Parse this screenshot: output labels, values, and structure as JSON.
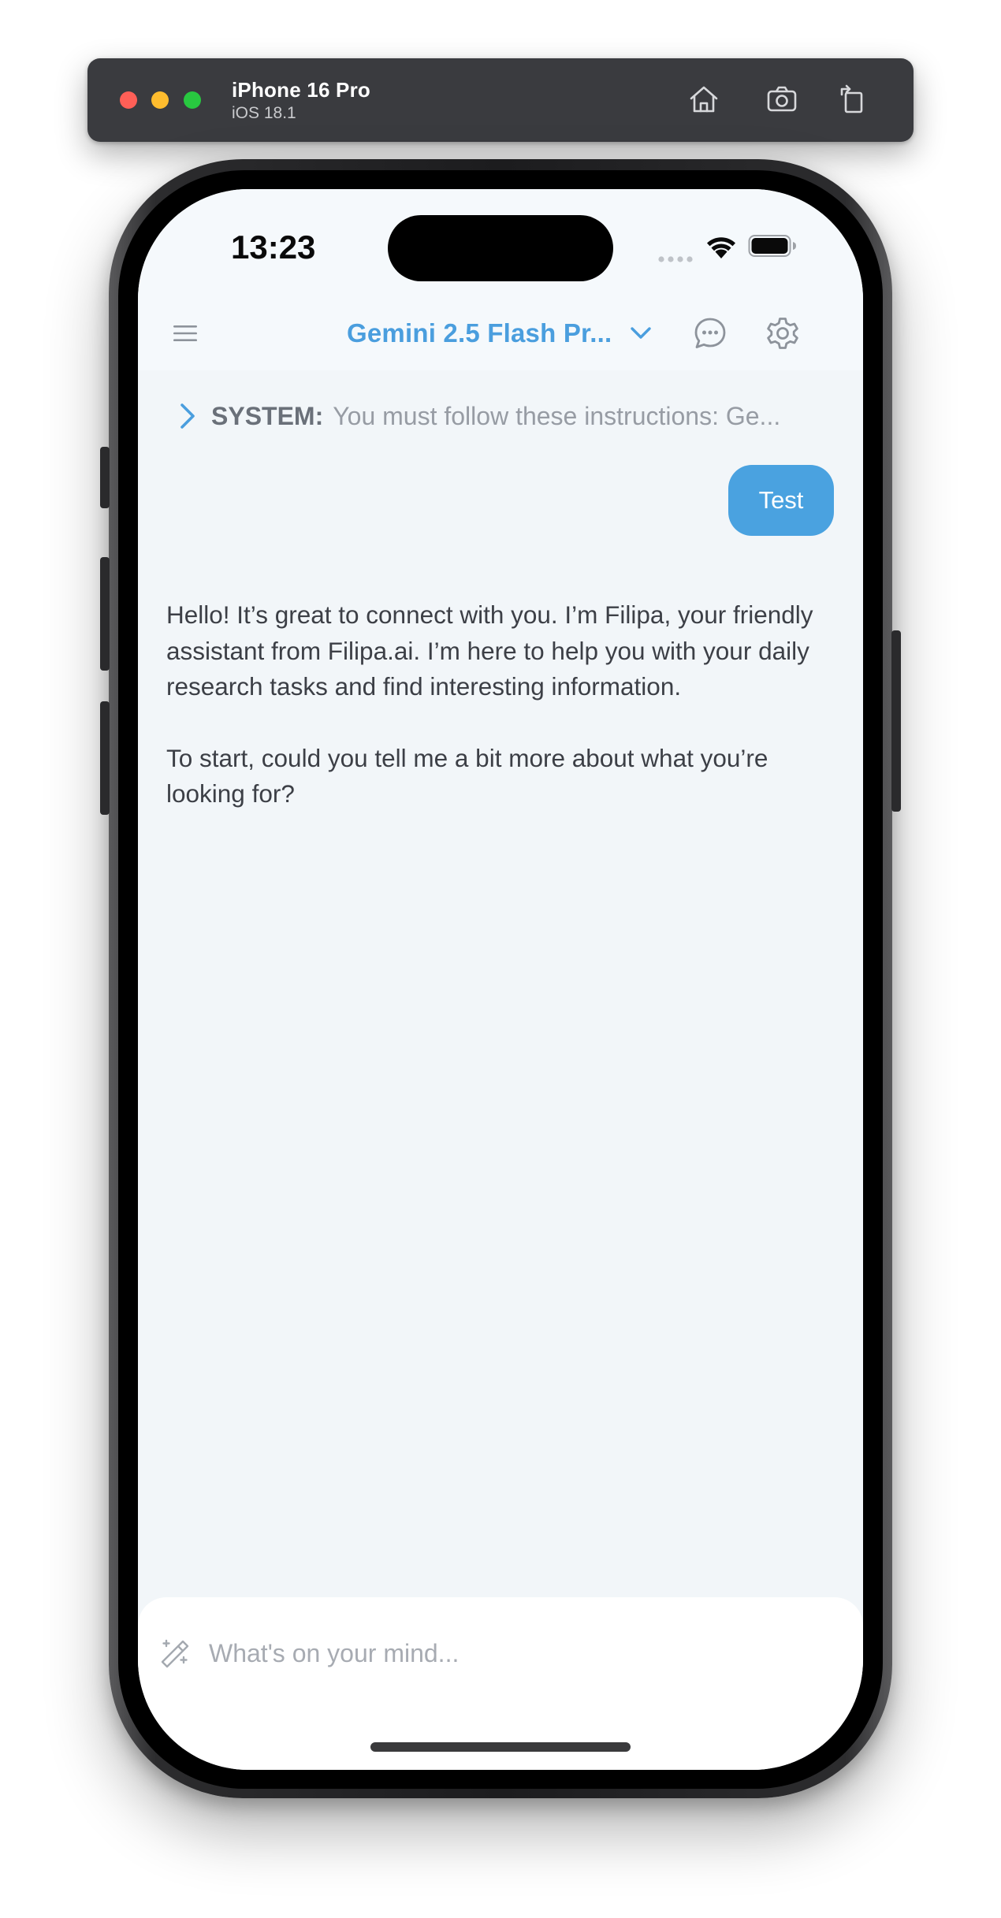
{
  "simulator": {
    "device_name": "iPhone 16 Pro",
    "os_version": "iOS 18.1",
    "icons": [
      "home-icon",
      "screenshot-icon",
      "rotate-icon"
    ]
  },
  "status_bar": {
    "time": "13:23",
    "icons": [
      "signal-icon",
      "wifi-icon",
      "battery-icon"
    ]
  },
  "header": {
    "model_name": "Gemini 2.5 Flash Pr...",
    "icons": [
      "menu-icon",
      "chevron-down-icon",
      "chat-bubble-icon",
      "gear-icon"
    ]
  },
  "system_prompt": {
    "label": "SYSTEM:",
    "preview": "You must follow these instructions: Ge..."
  },
  "messages": {
    "user": "Test",
    "assistant": {
      "paragraph_1": "Hello! It’s great to connect with you. I’m Filipa, your friendly assistant from Filipa.ai. I’m here to help you with your daily research tasks and find interesting information.",
      "paragraph_2": "To start, could you tell me a bit more about what you’re looking for?"
    }
  },
  "composer": {
    "placeholder": "What's on your mind...",
    "value": ""
  },
  "colors": {
    "accent": "#4aa2e0",
    "screen_background": "#f2f6f9",
    "text": "#3c3f46",
    "muted_text": "#979ca4",
    "simulator_bar": "#3a3b3f"
  }
}
